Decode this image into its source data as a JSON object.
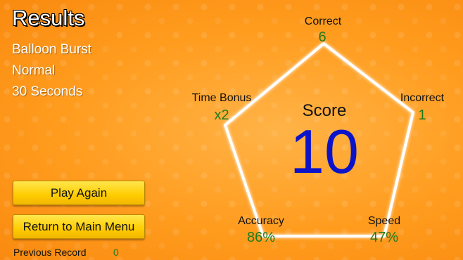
{
  "title": "Results",
  "game_info": {
    "game_name": "Balloon Burst",
    "difficulty": "Normal",
    "duration": "30 Seconds"
  },
  "buttons": {
    "play_again": "Play Again",
    "main_menu": "Return to Main Menu"
  },
  "previous_record": {
    "label": "Previous Record",
    "value": "0"
  },
  "score": {
    "label": "Score",
    "value": "10"
  },
  "stats": {
    "correct": {
      "label": "Correct",
      "value": "6"
    },
    "incorrect": {
      "label": "Incorrect",
      "value": "1"
    },
    "speed": {
      "label": "Speed",
      "value": "47%"
    },
    "accuracy": {
      "label": "Accuracy",
      "value": "86%"
    },
    "time_bonus": {
      "label": "Time Bonus",
      "value": "x2"
    }
  },
  "colors": {
    "background": "#ff9c1e",
    "value_green": "#1f7a1f",
    "score_blue": "#0b14c8",
    "button_yellow": "#ffcc00"
  }
}
